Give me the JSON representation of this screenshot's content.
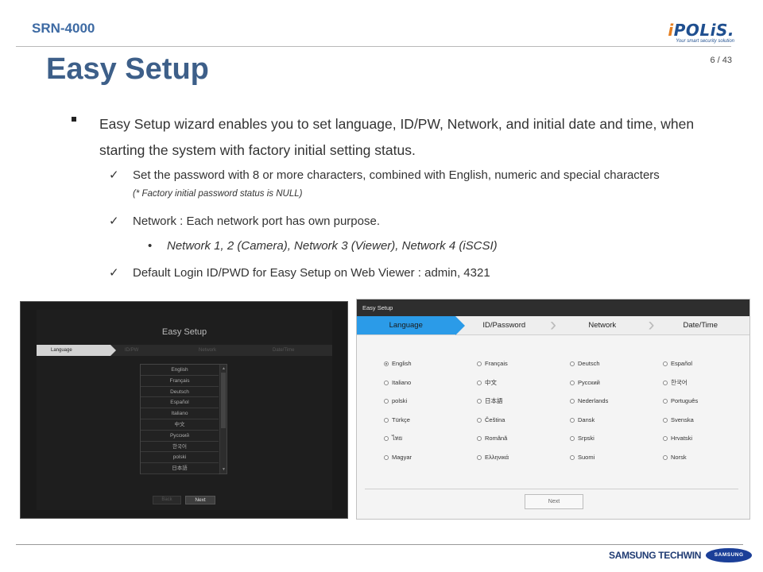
{
  "header": {
    "model": "SRN-4000",
    "brand_i": "i",
    "brand_rest": "POLiS.",
    "brand_tagline": "Your smart security solution",
    "page": "6 / 43",
    "title": "Easy Setup"
  },
  "content": {
    "main_bullet": "Easy Setup wizard enables you to set language, ID/PW, Network, and initial date and time, when starting the system with factory initial setting status.",
    "check_mark": "✓",
    "checks": [
      "Set the password with 8 or more characters, combined with English, numeric and special characters",
      "Network  : Each network port has own purpose.",
      "Default Login ID/PWD  for Easy Setup on Web Viewer : admin, 4321"
    ],
    "password_note": "(* Factory initial  password status is NULL)",
    "sub_bullet_dot": "•",
    "network_detail": "Network 1, 2 (Camera),  Network 3 (Viewer),  Network 4 (iSCSI)"
  },
  "monitor_shot": {
    "title": "Easy Setup",
    "steps": [
      "Language",
      "ID/PW",
      "Network",
      "Date/Time"
    ],
    "languages": [
      "English",
      "Français",
      "Deutsch",
      "Español",
      "Italiano",
      "中文",
      "Русский",
      "한국어",
      "polski",
      "日本語"
    ],
    "scroll_up": "▲",
    "scroll_down": "▼",
    "back_label": "Back",
    "next_label": "Next"
  },
  "web_shot": {
    "window_title": "Easy Setup",
    "steps": [
      "Language",
      "ID/Password",
      "Network",
      "Date/Time"
    ],
    "selected": "English",
    "languages": [
      "English",
      "Français",
      "Deutsch",
      "Español",
      "Italiano",
      "中文",
      "Русский",
      "한국어",
      "polski",
      "日本語",
      "Nederlands",
      "Português",
      "Türkçe",
      "Čeština",
      "Dansk",
      "Svenska",
      "ไทย",
      "Română",
      "Srpski",
      "Hrvatski",
      "Magyar",
      "Ελληνικά",
      "Suomi",
      "Norsk"
    ],
    "next_label": "Next"
  },
  "footer": {
    "company": "SAMSUNG TECHWIN",
    "logo": "SAMSUNG"
  },
  "colors": {
    "title": "#3d5f89",
    "model": "#3d6aa3",
    "step_active": "#2b9be8"
  }
}
